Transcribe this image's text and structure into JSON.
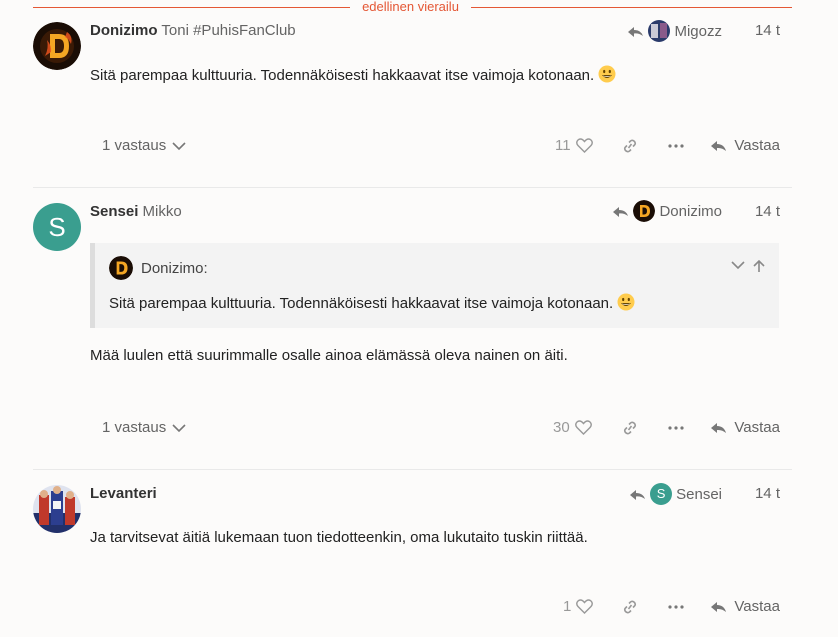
{
  "divider": {
    "label": "edellinen vierailu"
  },
  "posts": [
    {
      "username": "Donizimo",
      "fullname": "Toni #PuhisFanClub",
      "reply_to": "Migozz",
      "date": "14 t",
      "text": "Sitä parempaa kulttuuria. Todennäköisesti hakkaavat itse vaimoja kotonaan.",
      "replies": "1 vastaus",
      "likes": "11",
      "reply_label": "Vastaa"
    },
    {
      "username": "Sensei",
      "fullname": "Mikko",
      "avatar_letter": "S",
      "reply_to": "Donizimo",
      "date": "14 t",
      "quote": {
        "author": "Donizimo:",
        "text": "Sitä parempaa kulttuuria. Todennäköisesti hakkaavat itse vaimoja kotonaan."
      },
      "text": "Mää luulen että suurimmalle osalle ainoa elämässä oleva nainen on äiti.",
      "replies": "1 vastaus",
      "likes": "30",
      "reply_label": "Vastaa"
    },
    {
      "username": "Levanteri",
      "fullname": "",
      "reply_to": "Sensei",
      "reply_to_letter": "S",
      "date": "14 t",
      "text": "Ja tarvitsevat äitiä lukemaan tuon tiedotteenkin, oma lukutaito tuskin riittää.",
      "likes": "1",
      "reply_label": "Vastaa"
    }
  ],
  "colors": {
    "accent": "#e45735",
    "sensei_avatar": "#3a9e8f"
  },
  "icons": [
    "reply-arrow-icon",
    "heart-icon",
    "link-icon",
    "more-icon",
    "chevron-down-icon",
    "chevron-up-icon",
    "emoji-smiley-icon"
  ]
}
